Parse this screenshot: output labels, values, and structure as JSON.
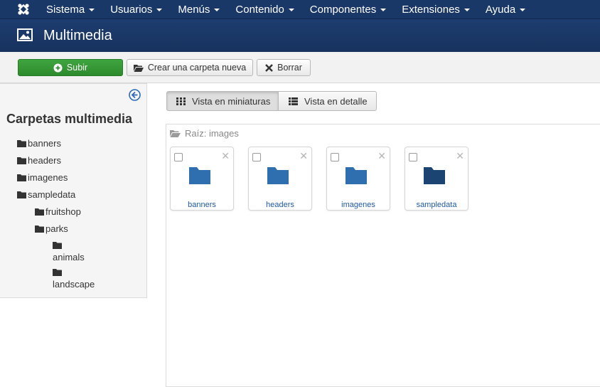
{
  "topnav": {
    "menu": [
      {
        "label": "Sistema"
      },
      {
        "label": "Usuarios"
      },
      {
        "label": "Menús"
      },
      {
        "label": "Contenido"
      },
      {
        "label": "Componentes"
      },
      {
        "label": "Extensiones"
      },
      {
        "label": "Ayuda"
      }
    ]
  },
  "header": {
    "title": "Multimedia",
    "icon": "image-icon"
  },
  "toolbar": {
    "upload_label": "Subir",
    "new_folder_label": "Crear una carpeta nueva",
    "delete_label": "Borrar"
  },
  "sidebar": {
    "title": "Carpetas multimedia",
    "tree": {
      "banners": "banners",
      "headers": "headers",
      "imagenes": "imagenes",
      "sampledata": "sampledata",
      "fruitshop": "fruitshop",
      "parks": "parks",
      "animals": "animals",
      "landscape": "landscape"
    }
  },
  "view": {
    "thumbs_label": "Vista en miniaturas",
    "detail_label": "Vista en detalle"
  },
  "breadcrumb": "Raíz: images",
  "folders": [
    {
      "name": "banners",
      "color": "#2f6fb0"
    },
    {
      "name": "headers",
      "color": "#2f6fb0"
    },
    {
      "name": "imagenes",
      "color": "#2f6fb0"
    },
    {
      "name": "sampledata",
      "color": "#1c4472"
    }
  ],
  "colors": {
    "nav": "#1a3867",
    "success": "#2d8a2d",
    "link": "#1f5aa6"
  }
}
